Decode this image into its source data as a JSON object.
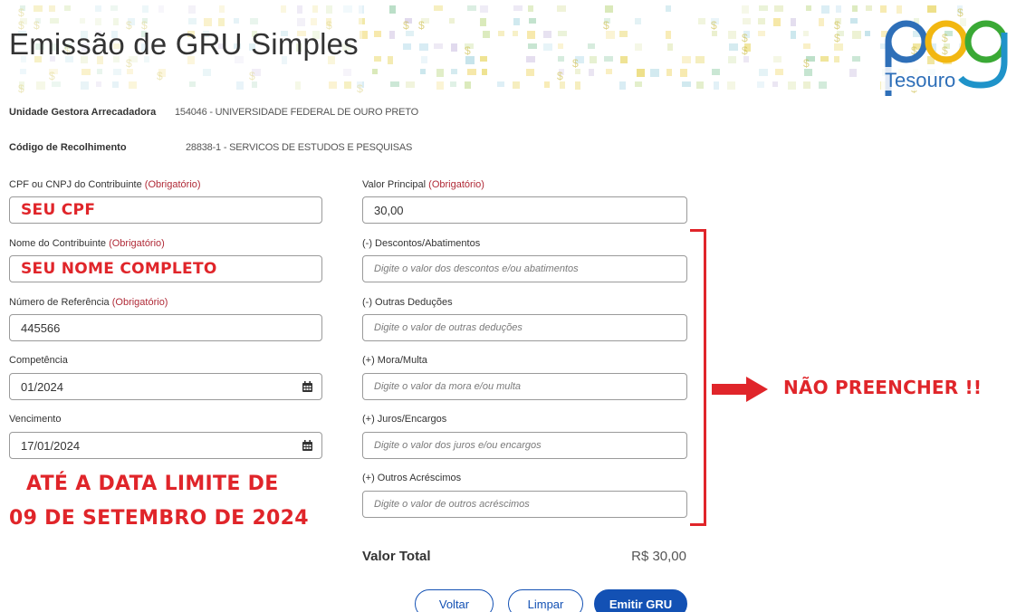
{
  "header": {
    "title": "Emissão de GRU Simples",
    "logo_text_main": "pag",
    "logo_text_sub": "Tesouro",
    "logo_colors": [
      "#2e6fb8",
      "#f2b711",
      "#3aa935",
      "#1f93c9"
    ]
  },
  "info": {
    "unidade_label": "Unidade Gestora Arrecadadora",
    "unidade_value": "154046 - UNIVERSIDADE FEDERAL DE OURO PRETO",
    "codigo_label": "Código de Recolhimento",
    "codigo_value": "28838-1 - SERVICOS DE ESTUDOS E PESQUISAS"
  },
  "form": {
    "required_tag": "(Obrigatório)",
    "cpf": {
      "label": "CPF ou CNPJ do Contribuinte",
      "value": "SEU CPF"
    },
    "nome": {
      "label": "Nome do Contribuinte",
      "value": "SEU NOME COMPLETO"
    },
    "referencia": {
      "label": "Número de Referência",
      "value": "445566"
    },
    "competencia": {
      "label": "Competência",
      "value": "01/2024",
      "icon": "calendar-icon"
    },
    "vencimento": {
      "label": "Vencimento",
      "value": "17/01/2024",
      "icon": "calendar-icon"
    },
    "valor_principal": {
      "label": "Valor Principal",
      "value": "30,00"
    },
    "descontos": {
      "label": "(-) Descontos/Abatimentos",
      "placeholder": "Digite o valor dos descontos e/ou abatimentos"
    },
    "deducoes": {
      "label": "(-) Outras Deduções",
      "placeholder": "Digite o valor de outras deduções"
    },
    "mora": {
      "label": "(+) Mora/Multa",
      "placeholder": "Digite o valor da mora e/ou multa"
    },
    "juros": {
      "label": "(+) Juros/Encargos",
      "placeholder": "Digite o valor dos juros e/ou encargos"
    },
    "acrescimos": {
      "label": "(+) Outros Acréscimos",
      "placeholder": "Digite o valor de outros acréscimos"
    }
  },
  "annotations": {
    "deadline_line1": "ATÉ A DATA LIMITE DE",
    "deadline_line2": "09 DE SETEMBRO DE 2024",
    "nao_preencher": "NÃO PREENCHER !!",
    "color": "#e0252a"
  },
  "total": {
    "label": "Valor Total",
    "value": "R$ 30,00"
  },
  "buttons": {
    "voltar": "Voltar",
    "limpar": "Limpar",
    "emitir": "Emitir GRU"
  },
  "colors": {
    "primary": "#1351b4",
    "required": "#b02a37"
  }
}
